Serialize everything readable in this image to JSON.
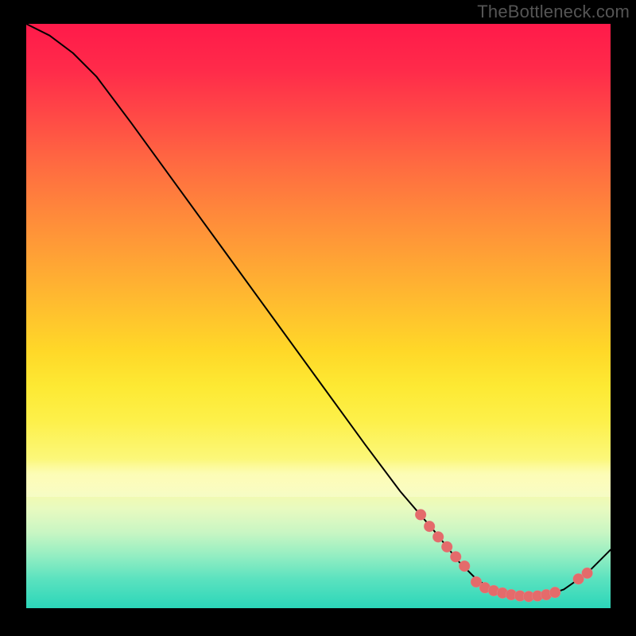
{
  "watermark": "TheBottleneck.com",
  "chart_data": {
    "type": "line",
    "title": "",
    "xlabel": "",
    "ylabel": "",
    "xlim": [
      0,
      100
    ],
    "ylim": [
      0,
      100
    ],
    "grid": false,
    "legend": false,
    "curve": {
      "x": [
        0,
        4,
        8,
        12,
        18,
        26,
        34,
        42,
        50,
        58,
        64,
        70,
        74,
        77,
        80,
        83,
        86,
        89,
        92,
        96,
        100
      ],
      "y": [
        100,
        98,
        95,
        91,
        83,
        72,
        61,
        50,
        39,
        28,
        20,
        13,
        8,
        5,
        3,
        2.2,
        2,
        2.2,
        3.2,
        6,
        10
      ]
    },
    "markers": [
      {
        "x": 67.5,
        "y": 16.0
      },
      {
        "x": 69.0,
        "y": 14.0
      },
      {
        "x": 70.5,
        "y": 12.2
      },
      {
        "x": 72.0,
        "y": 10.5
      },
      {
        "x": 73.5,
        "y": 8.8
      },
      {
        "x": 75.0,
        "y": 7.2
      },
      {
        "x": 77.0,
        "y": 4.5
      },
      {
        "x": 78.5,
        "y": 3.5
      },
      {
        "x": 80.0,
        "y": 3.0
      },
      {
        "x": 81.5,
        "y": 2.6
      },
      {
        "x": 83.0,
        "y": 2.3
      },
      {
        "x": 84.5,
        "y": 2.1
      },
      {
        "x": 86.0,
        "y": 2.0
      },
      {
        "x": 87.5,
        "y": 2.1
      },
      {
        "x": 89.0,
        "y": 2.3
      },
      {
        "x": 90.5,
        "y": 2.7
      },
      {
        "x": 94.5,
        "y": 5.0
      },
      {
        "x": 96.0,
        "y": 6.0
      }
    ],
    "colors": {
      "curve": "#000000",
      "marker_fill": "#e46b6b",
      "marker_stroke": "#d7a4a4"
    }
  }
}
